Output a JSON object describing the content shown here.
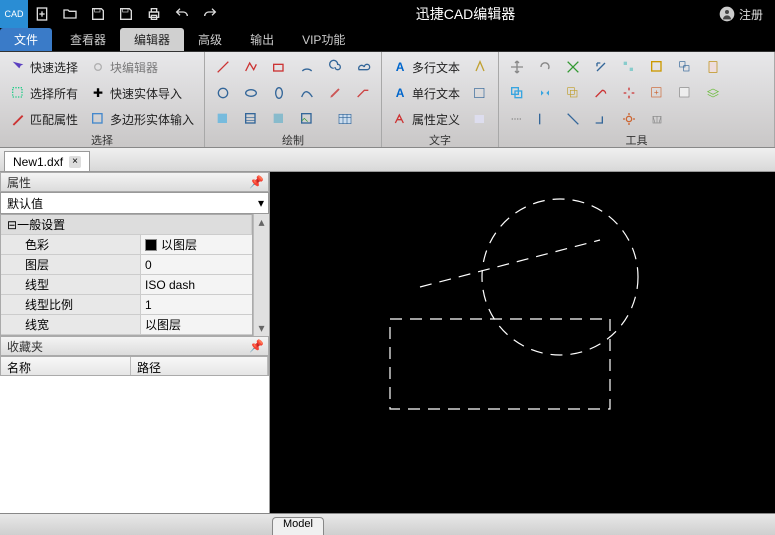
{
  "app_title": "迅捷CAD编辑器",
  "register_label": "注册",
  "tabs": {
    "file": "文件",
    "viewer": "查看器",
    "editor": "编辑器",
    "advanced": "高级",
    "output": "输出",
    "vip": "VIP功能"
  },
  "ribbon": {
    "quick_select": "快速选择",
    "block_editor": "块编辑器",
    "select_all": "选择所有",
    "fast_entity_import": "快速实体导入",
    "match_props": "匹配属性",
    "polygon_entity_input": "多边形实体输入",
    "group_select": "选择",
    "mtext": "多行文本",
    "stext": "单行文本",
    "attdef": "属性定义",
    "group_draw": "绘制",
    "group_text": "文字",
    "group_tools": "工具"
  },
  "file_tab": "New1.dxf",
  "props": {
    "panel_title": "属性",
    "select_value": "默认值",
    "cat_general": "一般设置",
    "color_k": "色彩",
    "color_v": "以图层",
    "layer_k": "图层",
    "layer_v": "0",
    "ltype_k": "线型",
    "ltype_v": "ISO dash",
    "ltscale_k": "线型比例",
    "ltscale_v": "1",
    "lweight_k": "线宽",
    "lweight_v": "以图层"
  },
  "fav": {
    "title": "收藏夹",
    "col_name": "名称",
    "col_path": "路径"
  },
  "model_tab": "Model"
}
